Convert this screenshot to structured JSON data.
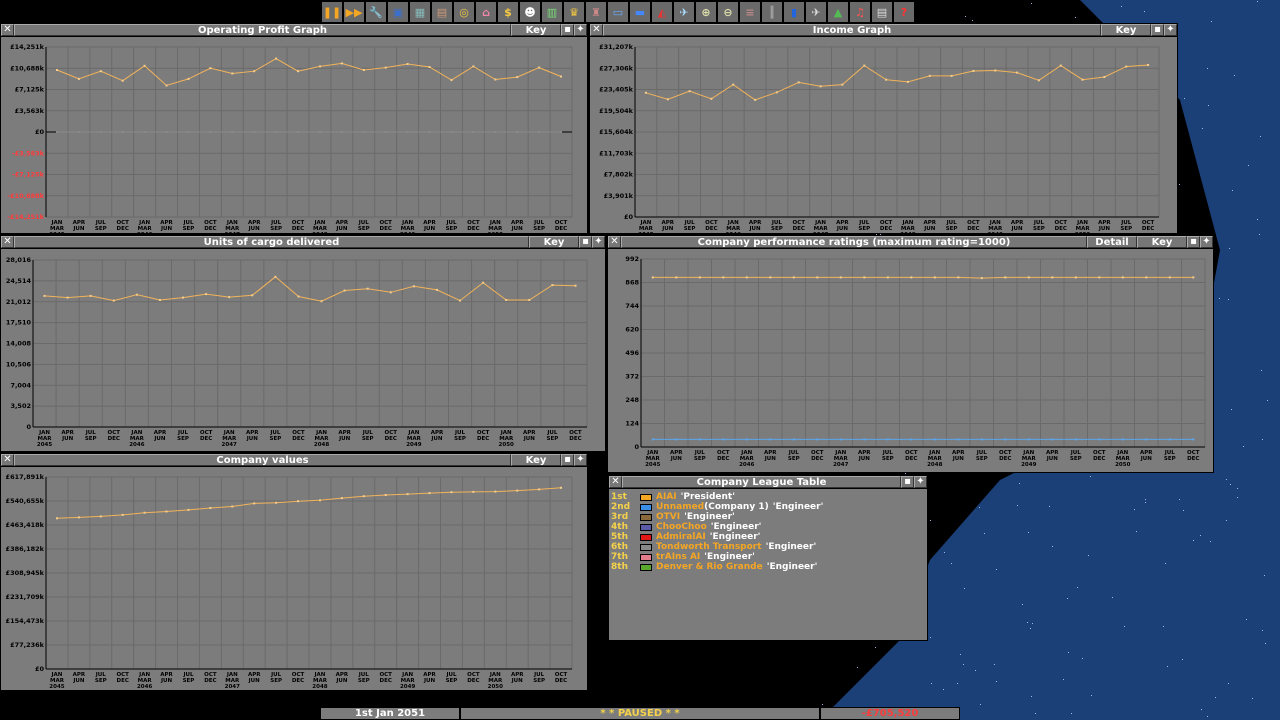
{
  "toolbar": {
    "buttons": [
      {
        "name": "pause-icon",
        "glyph": "❚❚",
        "color": "#f5a623"
      },
      {
        "name": "fast-forward-icon",
        "glyph": "▶▶",
        "color": "#f5a623"
      },
      {
        "name": "settings-icon",
        "glyph": "🔧",
        "color": "#ccc"
      },
      {
        "name": "save-icon",
        "glyph": "▣",
        "color": "#3a6fd0"
      },
      {
        "name": "map-icon",
        "glyph": "▦",
        "color": "#8bb"
      },
      {
        "name": "town-directory-icon",
        "glyph": "▤",
        "color": "#c97"
      },
      {
        "name": "subsidies-icon",
        "glyph": "◎",
        "color": "#f5c842"
      },
      {
        "name": "station-list-icon",
        "glyph": "⌂",
        "color": "#e8a"
      },
      {
        "name": "finances-icon",
        "glyph": "$",
        "color": "#f5c842"
      },
      {
        "name": "company-icon",
        "glyph": "☻",
        "color": "#fff"
      },
      {
        "name": "graphs-icon",
        "glyph": "▥",
        "color": "#7d7"
      },
      {
        "name": "league-table-icon",
        "glyph": "♛",
        "color": "#f5c842"
      },
      {
        "name": "industries-icon",
        "glyph": "♜",
        "color": "#c88"
      },
      {
        "name": "trains-icon",
        "glyph": "▭",
        "color": "#6af"
      },
      {
        "name": "road-vehicles-icon",
        "glyph": "▬",
        "color": "#48f"
      },
      {
        "name": "ships-icon",
        "glyph": "◭",
        "color": "#e33"
      },
      {
        "name": "aircraft-icon",
        "glyph": "✈",
        "color": "#adf"
      },
      {
        "name": "zoom-in-icon",
        "glyph": "⊕",
        "color": "#dda"
      },
      {
        "name": "zoom-out-icon",
        "glyph": "⊖",
        "color": "#dda"
      },
      {
        "name": "build-railway-icon",
        "glyph": "≡",
        "color": "#b88"
      },
      {
        "name": "build-road-icon",
        "glyph": "║",
        "color": "#bbb"
      },
      {
        "name": "build-water-icon",
        "glyph": "▮",
        "color": "#26d"
      },
      {
        "name": "build-airport-icon",
        "glyph": "✈",
        "color": "#ddd"
      },
      {
        "name": "landscaping-icon",
        "glyph": "▲",
        "color": "#5b5"
      },
      {
        "name": "music-icon",
        "glyph": "♫",
        "color": "#f55"
      },
      {
        "name": "messages-icon",
        "glyph": "▤",
        "color": "#ddd"
      },
      {
        "name": "help-icon",
        "glyph": "?",
        "color": "#f33"
      }
    ]
  },
  "xaxis": {
    "pairs": [
      [
        "JAN",
        "MAR"
      ],
      [
        "APR",
        "JUN"
      ],
      [
        "JUL",
        "SEP"
      ],
      [
        "OCT",
        "DEC"
      ]
    ],
    "years": [
      "2045",
      "2046",
      "2047",
      "2048",
      "2049",
      "2050"
    ]
  },
  "colors": {
    "series": "#f2b35a",
    "series2": "#f7cd8a",
    "blue": "#5aa6ee",
    "negative": "#ff3b3b",
    "axis": "#000"
  },
  "windows": {
    "profit": {
      "title": "Operating Profit Graph",
      "key": "Key"
    },
    "income": {
      "title": "Income Graph",
      "key": "Key"
    },
    "cargo": {
      "title": "Units of cargo delivered",
      "key": "Key"
    },
    "performance": {
      "title": "Company performance ratings (maximum rating=1000)",
      "detail": "Detail",
      "key": "Key"
    },
    "values": {
      "title": "Company values",
      "key": "Key"
    },
    "league": {
      "title": "Company League Table"
    }
  },
  "chart_data": [
    {
      "id": "profit",
      "type": "line",
      "title": "Operating Profit Graph",
      "ticks": [
        "£14,251k",
        "£10,688k",
        "£7,125k",
        "£3,563k",
        "£0",
        "-£3,563k",
        "-£7,125k",
        "-£10,688k",
        "-£14,251k"
      ],
      "ylim": [
        -14251,
        14251
      ],
      "series": [
        {
          "values": [
            10400,
            8900,
            10200,
            8600,
            11100,
            7800,
            8900,
            10700,
            9800,
            10200,
            12300,
            10200,
            11000,
            11500,
            10400,
            10800,
            11400,
            10900,
            8700,
            11000,
            8800,
            9200,
            10800,
            9300
          ]
        },
        {
          "values": [
            0,
            0,
            0,
            0,
            0,
            0,
            0,
            0,
            0,
            0,
            0,
            0,
            0,
            0,
            0,
            0,
            0,
            0,
            0,
            0,
            0,
            0,
            0,
            0
          ]
        }
      ]
    },
    {
      "id": "income",
      "type": "line",
      "title": "Income Graph",
      "ticks": [
        "£31,207k",
        "£27,306k",
        "£23,405k",
        "£19,504k",
        "£15,604k",
        "£11,703k",
        "£7,802k",
        "£3,901k",
        "£0"
      ],
      "ylim": [
        0,
        31207
      ],
      "series": [
        {
          "values": [
            22800,
            21600,
            23100,
            21700,
            24300,
            21500,
            22900,
            24700,
            24000,
            24300,
            27800,
            25200,
            24800,
            25900,
            25900,
            26800,
            26900,
            26500,
            25100,
            27800,
            25200,
            25700,
            27600,
            27900
          ]
        }
      ]
    },
    {
      "id": "cargo",
      "type": "line",
      "title": "Units of cargo delivered",
      "ticks": [
        "28,016",
        "24,514",
        "21,012",
        "17,510",
        "14,008",
        "10,506",
        "7,004",
        "3,502",
        "0"
      ],
      "ylim": [
        0,
        28016
      ],
      "series": [
        {
          "values": [
            22000,
            21700,
            22000,
            21200,
            22200,
            21300,
            21700,
            22300,
            21800,
            22100,
            25200,
            21900,
            21100,
            22900,
            23200,
            22600,
            23600,
            23000,
            21200,
            24200,
            21300,
            21300,
            23800,
            23700
          ]
        }
      ]
    },
    {
      "id": "performance",
      "type": "line",
      "title": "Company performance ratings (maximum rating=1000)",
      "ticks": [
        "992",
        "868",
        "744",
        "620",
        "496",
        "372",
        "248",
        "124",
        "0"
      ],
      "ylim": [
        0,
        992
      ],
      "series": [
        {
          "values": [
            895,
            895,
            895,
            895,
            895,
            895,
            895,
            895,
            895,
            895,
            895,
            895,
            895,
            895,
            891,
            895,
            895,
            895,
            895,
            895,
            895,
            895,
            895,
            895
          ]
        },
        {
          "values": [
            40,
            40,
            40,
            40,
            40,
            40,
            40,
            40,
            40,
            40,
            40,
            40,
            40,
            40,
            40,
            40,
            40,
            40,
            40,
            40,
            40,
            40,
            40,
            40
          ]
        }
      ]
    },
    {
      "id": "values",
      "type": "line",
      "title": "Company values",
      "ticks": [
        "£617,891k",
        "£540,655k",
        "£463,418k",
        "£386,182k",
        "£308,945k",
        "£231,709k",
        "£154,473k",
        "£77,236k",
        "£0"
      ],
      "ylim": [
        0,
        617891
      ],
      "series": [
        {
          "values": [
            485000,
            488000,
            491000,
            496000,
            503000,
            507000,
            512000,
            518000,
            523000,
            533000,
            535000,
            540000,
            543000,
            550000,
            556000,
            560000,
            563000,
            566000,
            569000,
            570000,
            571000,
            574000,
            578000,
            583000
          ]
        }
      ]
    }
  ],
  "league": [
    {
      "pos": "1st",
      "name": "AIAI",
      "rank": "'President'",
      "color": "#f5a623"
    },
    {
      "pos": "2nd",
      "name": "Unnamed",
      "extra": "(Company 1)",
      "rank": "'Engineer'",
      "color": "#3a8ee6"
    },
    {
      "pos": "3rd",
      "name": "OTVI",
      "rank": "'Engineer'",
      "color": "#8a6a3a"
    },
    {
      "pos": "4th",
      "name": "ChooChoo",
      "rank": "'Engineer'",
      "color": "#5a5aa8"
    },
    {
      "pos": "5th",
      "name": "AdmiralAI",
      "rank": "'Engineer'",
      "color": "#e01818"
    },
    {
      "pos": "6th",
      "name": "Tondworth Transport",
      "rank": "'Engineer'",
      "color": "#888888"
    },
    {
      "pos": "7th",
      "name": "trAIns AI",
      "rank": "'Engineer'",
      "color": "#e27b8a"
    },
    {
      "pos": "8th",
      "name": "Denver & Rio Grande",
      "rank": "'Engineer'",
      "color": "#5aa82e"
    }
  ],
  "status": {
    "date": "1st Jan 2051",
    "paused": "* * PAUSED * *",
    "money": "-£705,520"
  }
}
